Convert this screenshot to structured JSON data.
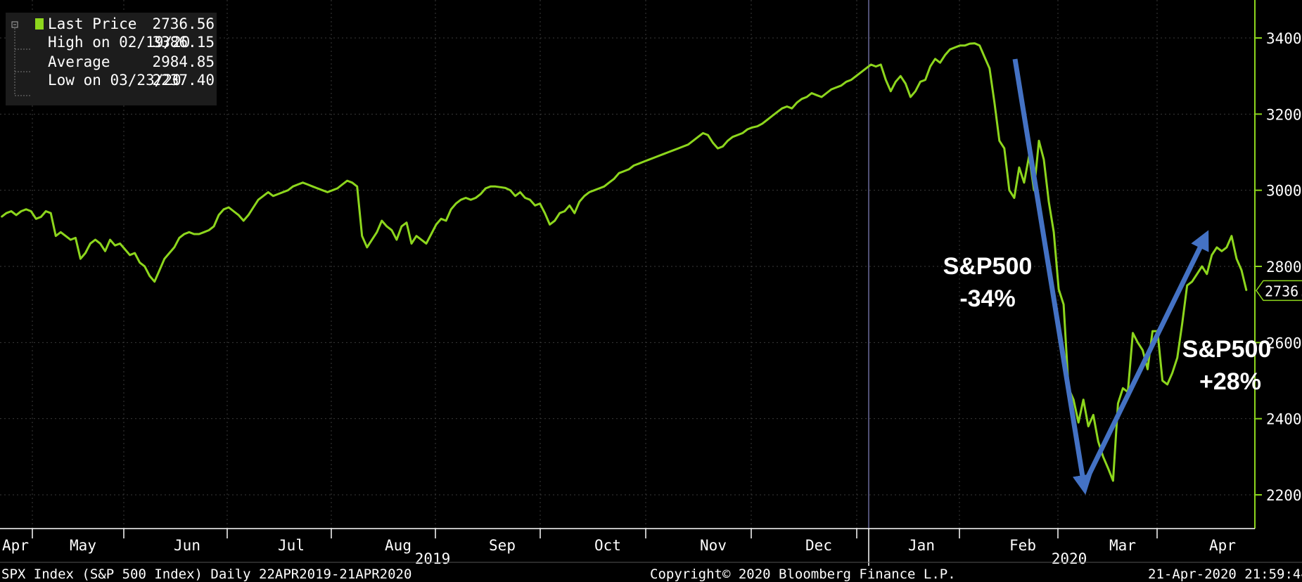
{
  "legend": {
    "last_label": "Last Price",
    "last_value": "2736.56",
    "high_label": "High on 02/19/20",
    "high_value": "3386.15",
    "avg_label": "Average",
    "avg_value": "2984.85",
    "low_label": "Low on 03/23/20",
    "low_value": "2237.40"
  },
  "footer": {
    "left": "SPX Index (S&P 500 Index)  Daily 22APR2019-21APR2020",
    "center": "Copyright© 2020 Bloomberg Finance L.P.",
    "right": "21-Apr-2020 21:59:44"
  },
  "annotations": {
    "down_line1": "S&P500",
    "down_line2": "-34%",
    "up_line1": "S&P500",
    "up_line2": "+28%"
  },
  "colors": {
    "line": "#8dd61d",
    "arrow": "#4472c4",
    "background": "#000000",
    "axis": "#8dd61d"
  },
  "chart_data": {
    "type": "line",
    "y_ticks": [
      2200,
      2400,
      2600,
      2800,
      3000,
      3200,
      3400
    ],
    "ylim": [
      2150,
      3500
    ],
    "months": [
      "Apr",
      "May",
      "Jun",
      "Jul",
      "Aug",
      "Sep",
      "Oct",
      "Nov",
      "Dec",
      "Jan",
      "Feb",
      "Mar",
      "Apr"
    ],
    "years": [
      "2019",
      "2020"
    ],
    "last_value_label": "2736.56",
    "series": [
      {
        "values": [
          2930,
          2940,
          2945,
          2935,
          2945,
          2950,
          2945,
          2925,
          2930,
          2945,
          2940,
          2880,
          2890,
          2880,
          2870,
          2875,
          2820,
          2835,
          2860,
          2870,
          2860,
          2840,
          2870,
          2855,
          2860,
          2845,
          2830,
          2835,
          2810,
          2800,
          2775,
          2760,
          2790,
          2820,
          2835,
          2850,
          2875,
          2885,
          2890,
          2885,
          2885,
          2890,
          2895,
          2905,
          2935,
          2950,
          2955,
          2945,
          2935,
          2920,
          2935,
          2955,
          2975,
          2985,
          2995,
          2985,
          2990,
          2995,
          3000,
          3010,
          3015,
          3020,
          3015,
          3010,
          3005,
          3000,
          2995,
          3000,
          3005,
          3015,
          3025,
          3020,
          3010,
          2880,
          2850,
          2870,
          2890,
          2920,
          2905,
          2895,
          2870,
          2905,
          2915,
          2860,
          2880,
          2870,
          2860,
          2885,
          2910,
          2925,
          2920,
          2950,
          2965,
          2975,
          2980,
          2975,
          2980,
          2990,
          3005,
          3010,
          3010,
          3008,
          3006,
          3000,
          2985,
          2995,
          2980,
          2975,
          2960,
          2965,
          2940,
          2910,
          2920,
          2940,
          2945,
          2960,
          2940,
          2970,
          2985,
          2995,
          3000,
          3005,
          3010,
          3020,
          3030,
          3045,
          3050,
          3055,
          3065,
          3070,
          3075,
          3080,
          3085,
          3090,
          3095,
          3100,
          3105,
          3110,
          3115,
          3120,
          3130,
          3140,
          3150,
          3145,
          3125,
          3110,
          3115,
          3130,
          3140,
          3145,
          3150,
          3160,
          3165,
          3168,
          3175,
          3185,
          3195,
          3205,
          3215,
          3220,
          3215,
          3230,
          3240,
          3245,
          3255,
          3250,
          3245,
          3255,
          3265,
          3270,
          3275,
          3285,
          3290,
          3300,
          3310,
          3320,
          3330,
          3325,
          3330,
          3290,
          3260,
          3285,
          3300,
          3280,
          3245,
          3260,
          3285,
          3290,
          3325,
          3345,
          3335,
          3355,
          3370,
          3375,
          3380,
          3380,
          3385,
          3386,
          3380,
          3350,
          3320,
          3230,
          3130,
          3110,
          3000,
          2980,
          3060,
          3020,
          3090,
          3000,
          3130,
          3080,
          2970,
          2890,
          2740,
          2700,
          2480,
          2450,
          2390,
          2450,
          2380,
          2410,
          2340,
          2300,
          2270,
          2237,
          2440,
          2480,
          2470,
          2625,
          2600,
          2580,
          2530,
          2630,
          2630,
          2500,
          2490,
          2520,
          2560,
          2650,
          2750,
          2760,
          2780,
          2800,
          2780,
          2830,
          2850,
          2840,
          2850,
          2880,
          2820,
          2790,
          2736.56
        ]
      }
    ]
  }
}
